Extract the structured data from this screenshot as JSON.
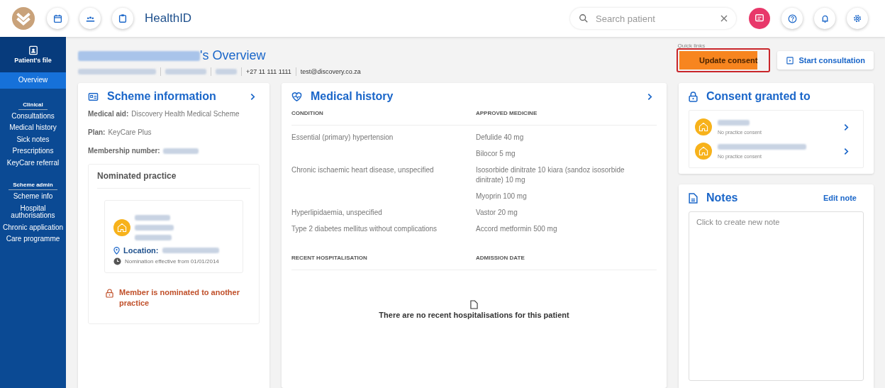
{
  "header": {
    "title": "HealthID",
    "search": {
      "placeholder": "Search patient"
    }
  },
  "sidebar": {
    "file_label": "Patient's file",
    "sections": [
      {
        "items": [
          {
            "label": "Overview",
            "selected": true
          }
        ]
      },
      {
        "heading": "Clinical",
        "items": [
          {
            "label": "Consultations",
            "selected": false
          },
          {
            "label": "Medical history",
            "selected": false
          },
          {
            "label": "Sick notes",
            "selected": false
          },
          {
            "label": "Prescriptions",
            "selected": false
          },
          {
            "label": "KeyCare referral",
            "selected": false
          }
        ]
      },
      {
        "heading": "Scheme admin",
        "items": [
          {
            "label": "Scheme info",
            "selected": false
          },
          {
            "label": "Hospital authorisations",
            "selected": false
          },
          {
            "label": "Chronic application",
            "selected": false
          },
          {
            "label": "Care programme",
            "selected": false
          }
        ]
      }
    ]
  },
  "patient": {
    "title_suffix": "'s Overview",
    "phone": "+27 11 111 1111",
    "email": "test@discovery.co.za"
  },
  "quick_links": {
    "label": "Quick links",
    "buttons": [
      {
        "label": "Update consent",
        "kind": "primary",
        "highlighted": true
      },
      {
        "label": "Start consultation",
        "kind": "secondary",
        "highlighted": false
      }
    ]
  },
  "scheme": {
    "title": "Scheme information",
    "fields": [
      {
        "label": "Medical aid:",
        "value": "Discovery Health Medical Scheme"
      },
      {
        "label": "Plan:",
        "value": "KeyCare Plus"
      },
      {
        "label": "Membership number:",
        "redacted": true
      }
    ],
    "nominated": {
      "title": "Nominated practice",
      "location_label": "Location:",
      "effective": "Nomination effective from 01/01/2014",
      "warning": "Member is nominated to another practice"
    }
  },
  "medical": {
    "title": "Medical history",
    "columns": [
      "CONDITION",
      "APPROVED MEDICINE"
    ],
    "rows": [
      {
        "condition": "Essential (primary) hypertension",
        "medicines": [
          "Defulide 40 mg",
          "Bilocor 5 mg"
        ]
      },
      {
        "condition": "Chronic ischaemic heart disease, unspecified",
        "medicines": [
          "Isosorbide dinitrate 10 kiara (sandoz isosorbide dinitrate) 10 mg",
          "Myoprin 100 mg"
        ]
      },
      {
        "condition": "Hyperlipidaemia, unspecified",
        "medicines": [
          "Vastor 20 mg"
        ]
      },
      {
        "condition": "Type 2 diabetes mellitus without complications",
        "medicines": [
          "Accord metformin 500 mg"
        ]
      }
    ],
    "hosp_columns": [
      "RECENT HOSPITALISATION",
      "ADMISSION DATE"
    ],
    "empty": "There are no recent hospitalisations for this patient"
  },
  "consent": {
    "title": "Consent granted to",
    "items": [
      {
        "status": "No practice consent"
      },
      {
        "status": "No practice consent"
      }
    ]
  },
  "notes": {
    "title": "Notes",
    "edit": "Edit note",
    "placeholder": "Click to create new note"
  }
}
